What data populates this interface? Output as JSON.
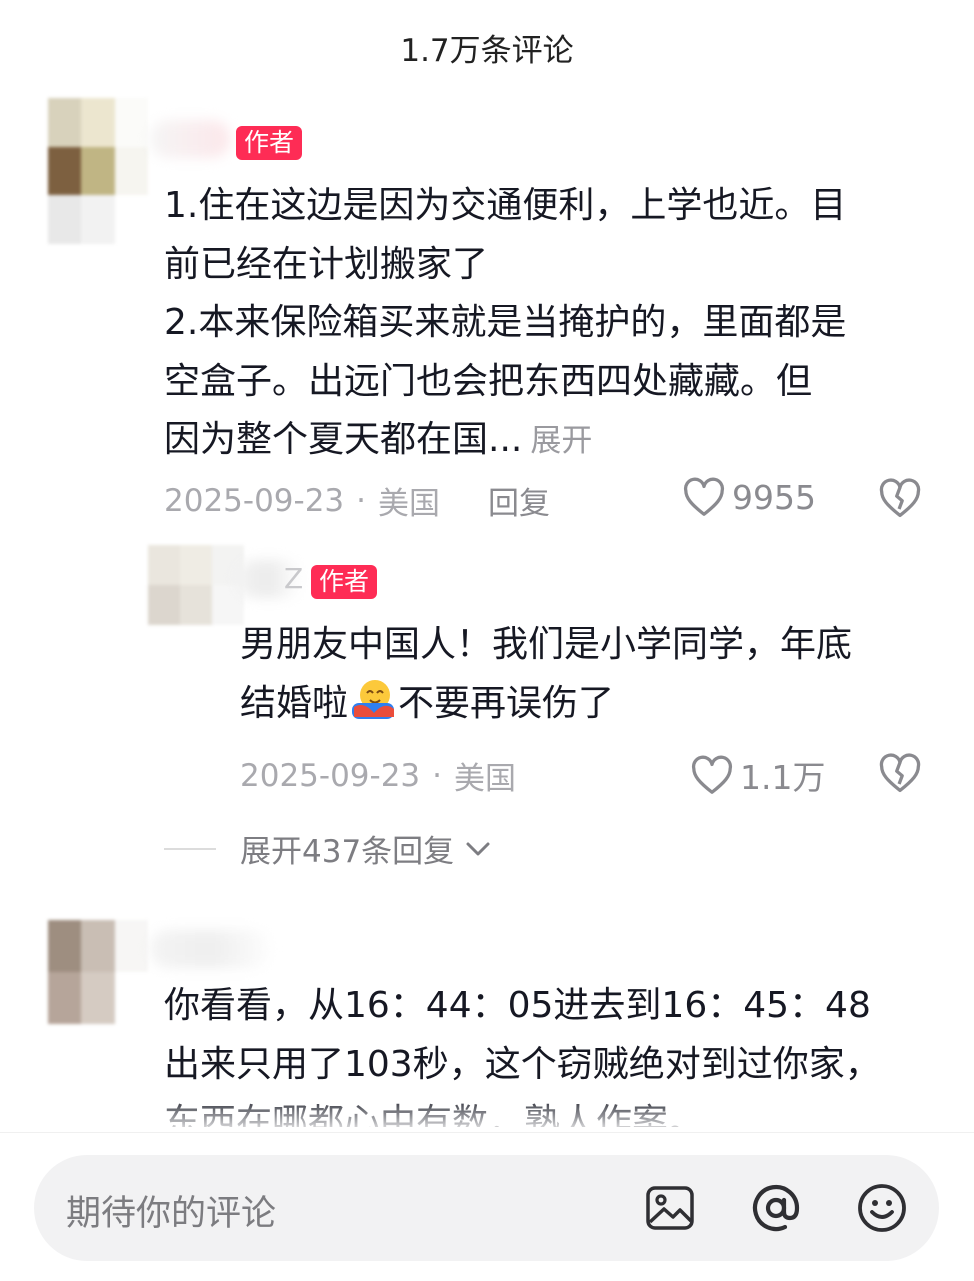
{
  "header": {
    "title": "1.7万条评论"
  },
  "comments": [
    {
      "badge": "作者",
      "text": "1.住在这边是因为交通便利，上学也近。目\n前已经在计划搬家了\n2.本来保险箱买来就是当掩护的，里面都是\n空盒子。出远门也会把东西四处藏藏。但\n因为整个夏天都在国...",
      "expand_label": "展开",
      "date": "2025-09-23",
      "location": "美国",
      "reply_label": "回复",
      "likes": "9955"
    },
    {
      "badge": "作者",
      "name_visible_fragment": "Z",
      "text_line1": "男朋友中国人！我们是小学同学，年底",
      "text_line2_a": "结婚啦",
      "text_line2_b": "不要再误伤了",
      "date": "2025-09-23",
      "location": "美国",
      "likes": "1.1万"
    },
    {
      "text": "你看看，从16：44：05进去到16：45：48\n出来只用了103秒，这个窃贼绝对到过你家，\n东西在哪都心中有数，熟人作案。"
    }
  ],
  "expand_replies": {
    "label": "展开437条回复"
  },
  "dot_separator": "·",
  "input": {
    "placeholder": "期待你的评论"
  },
  "icons": [
    "image-icon",
    "at-icon",
    "emoji-icon",
    "heart-outline-icon",
    "heart-broken-icon",
    "chevron-down-icon",
    "hug-emoji-icon"
  ],
  "colors": {
    "badge": "#fe2c55",
    "text": "#161823",
    "meta": "#a9a9ae",
    "input_bg": "#f2f2f3"
  }
}
